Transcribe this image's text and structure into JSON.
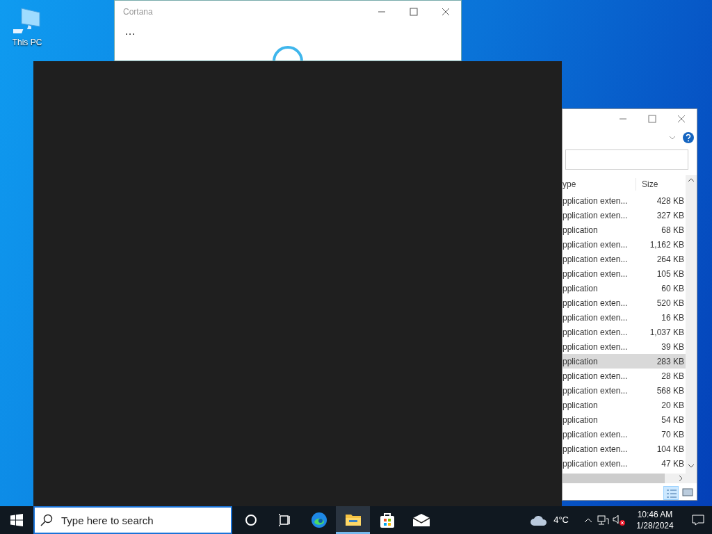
{
  "desktop_icons": [
    {
      "label": "This PC"
    }
  ],
  "cortana_window": {
    "title": "Cortana",
    "more": "…"
  },
  "explorer_window": {
    "columns": [
      "ype",
      "Size"
    ],
    "rows": [
      {
        "type": "pplication exten...",
        "size": "428 KB",
        "selected": false
      },
      {
        "type": "pplication exten...",
        "size": "327 KB",
        "selected": false
      },
      {
        "type": "pplication",
        "size": "68 KB",
        "selected": false
      },
      {
        "type": "pplication exten...",
        "size": "1,162 KB",
        "selected": false
      },
      {
        "type": "pplication exten...",
        "size": "264 KB",
        "selected": false
      },
      {
        "type": "pplication exten...",
        "size": "105 KB",
        "selected": false
      },
      {
        "type": "pplication",
        "size": "60 KB",
        "selected": false
      },
      {
        "type": "pplication exten...",
        "size": "520 KB",
        "selected": false
      },
      {
        "type": "pplication exten...",
        "size": "16 KB",
        "selected": false
      },
      {
        "type": "pplication exten...",
        "size": "1,037 KB",
        "selected": false
      },
      {
        "type": "pplication exten...",
        "size": "39 KB",
        "selected": false
      },
      {
        "type": "pplication",
        "size": "283 KB",
        "selected": true
      },
      {
        "type": "pplication exten...",
        "size": "28 KB",
        "selected": false
      },
      {
        "type": "pplication exten...",
        "size": "568 KB",
        "selected": false
      },
      {
        "type": "pplication",
        "size": "20 KB",
        "selected": false
      },
      {
        "type": "pplication",
        "size": "54 KB",
        "selected": false
      },
      {
        "type": "pplication exten...",
        "size": "70 KB",
        "selected": false
      },
      {
        "type": "pplication exten...",
        "size": "104 KB",
        "selected": false
      },
      {
        "type": "pplication exten...",
        "size": "47 KB",
        "selected": false
      }
    ]
  },
  "taskbar": {
    "search_placeholder": "Type here to search",
    "apps": [
      {
        "kind": "cortana",
        "active": false
      },
      {
        "kind": "taskview",
        "active": false
      },
      {
        "kind": "edge",
        "active": false
      },
      {
        "kind": "explorer",
        "active": true
      },
      {
        "kind": "store",
        "active": false
      },
      {
        "kind": "mail",
        "active": false
      }
    ],
    "temperature": "4°C",
    "time": "10:46 AM",
    "date": "1/28/2024"
  }
}
